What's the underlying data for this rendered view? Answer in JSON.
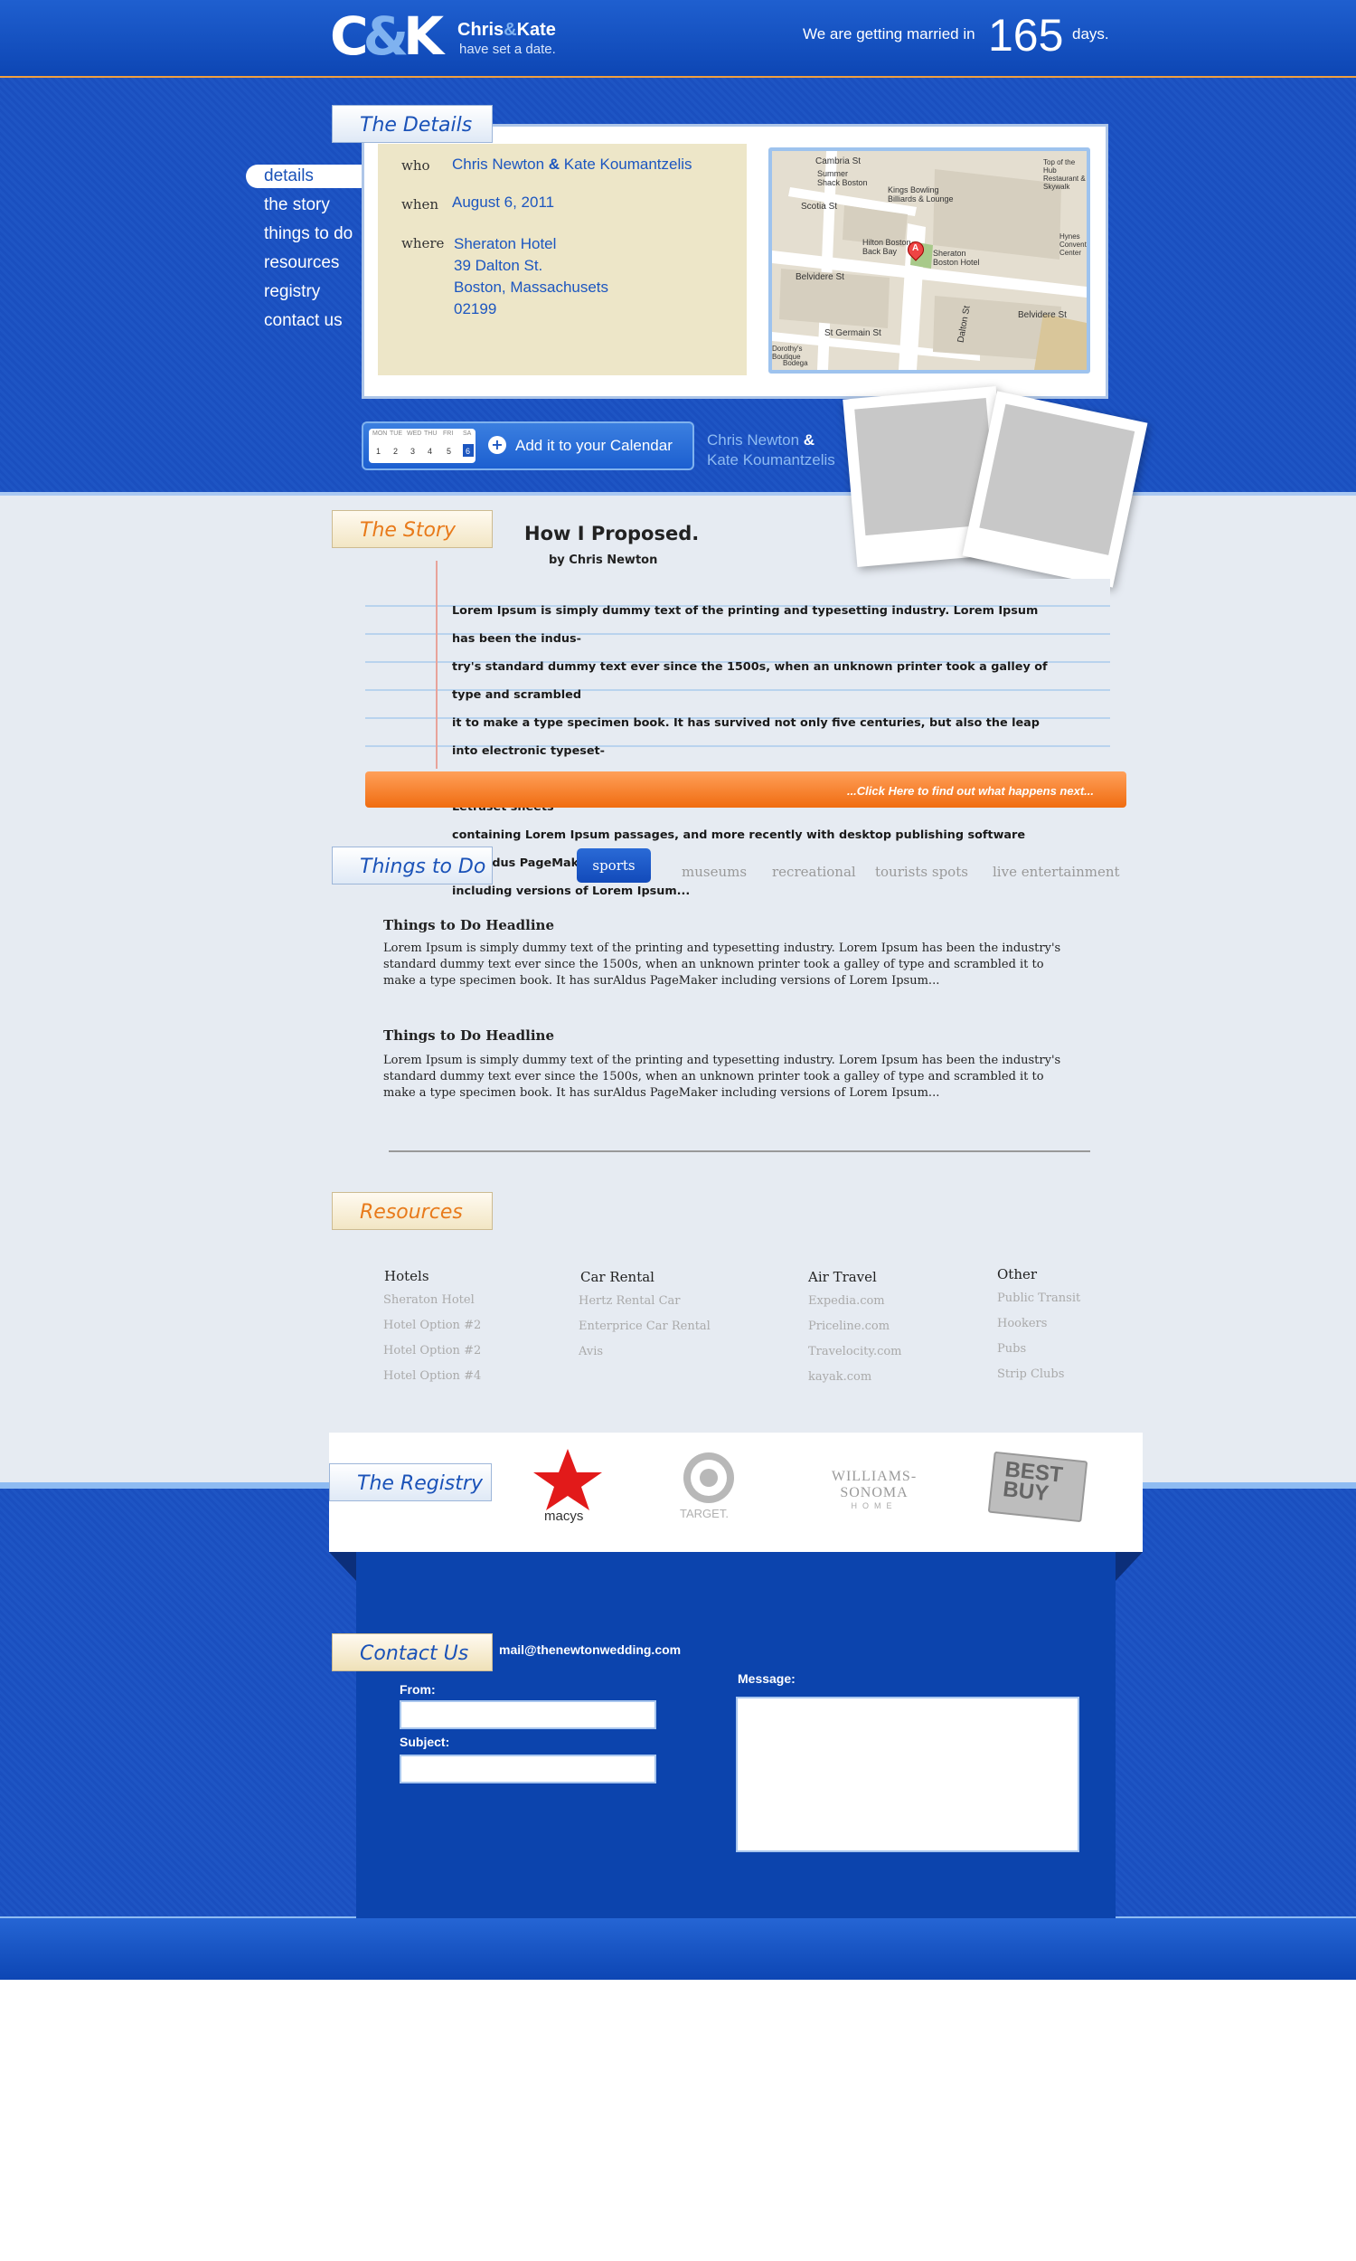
{
  "header": {
    "logo_initials_c": "C",
    "logo_amp": "&",
    "logo_initials_k": "K",
    "logo_name_chris": "Chris",
    "logo_name_kate": "Kate",
    "logo_subtitle": "have set a date.",
    "countdown_prefix": "We are getting married in",
    "countdown_days": "165",
    "countdown_suffix": "days."
  },
  "nav": [
    "details",
    "the story",
    "things to do",
    "resources",
    "registry",
    "contact us"
  ],
  "details": {
    "tab_label": "The Details",
    "who_label": "who",
    "who_name_1": "Chris Newton",
    "who_amp": "&",
    "who_name_2": "Kate Koumantzelis",
    "when_label": "when",
    "when_value": "August 6, 2011",
    "where_label": "where",
    "where_lines": [
      "Sheraton Hotel",
      "39 Dalton St.",
      "Boston, Massachusets",
      "02199"
    ]
  },
  "map": {
    "labels": [
      "Cambria St",
      "Summer Shack Boston",
      "Kings Bowling Billiards & Lounge",
      "Scotia St",
      "Hilton Boston Back Bay",
      "Sheraton Boston Hotel",
      "Belvidere St",
      "Dalton St",
      "Belvidere St",
      "St Germain St",
      "Dorothy's Boutique",
      "Bodega",
      "Top of the Hub Restaurant & Skywalk",
      "Hynes Convention Center"
    ],
    "marker": "A"
  },
  "calendar": {
    "days": [
      "MON",
      "TUE",
      "WED",
      "THU",
      "FRI",
      "SA"
    ],
    "nums": [
      "1",
      "2",
      "3",
      "4",
      "5",
      "6"
    ],
    "label": "Add it to your Calendar",
    "couple_1": "Chris Newton",
    "couple_amp": "&",
    "couple_2": "Kate Koumantzelis"
  },
  "story": {
    "tab_label": "The Story",
    "title": "How I Proposed.",
    "byline": "by Chris Newton",
    "lines": [
      "Lorem Ipsum is simply dummy text of the printing and typesetting industry. Lorem Ipsum has been the indus-",
      "try's standard dummy text ever since the 1500s, when an unknown printer took a galley of type and scrambled",
      "it to make a type specimen book. It has survived not only five centuries, but also the leap into electronic typeset-",
      "ting, remaining essentially unchanged. It was popularised in the 1960s with the release of Letraset sheets",
      "containing Lorem Ipsum passages, and more recently with desktop publishing software like Aldus PageMaker",
      "including versions of Lorem Ipsum..."
    ],
    "read_more": "...Click Here to find out what happens next..."
  },
  "things": {
    "tab_label": "Things to Do",
    "tabs": [
      "sports",
      "museums",
      "recreational",
      "tourists spots",
      "live entertainment"
    ],
    "items": [
      {
        "headline": "Things to Do Headline",
        "body": "Lorem Ipsum is simply dummy text of the printing and typesetting industry. Lorem Ipsum has been the industry's standard dummy text ever since the 1500s, when an unknown printer took a galley of type and scrambled it to make a type specimen book. It has surAldus PageMaker including versions of Lorem Ipsum..."
      },
      {
        "headline": "Things to Do Headline",
        "body": "Lorem Ipsum is simply dummy text of the printing and typesetting industry. Lorem Ipsum has been the industry's standard dummy text ever since the 1500s, when an unknown printer took a galley of type and scrambled it to make a type specimen book. It has surAldus PageMaker including versions of Lorem Ipsum..."
      }
    ]
  },
  "resources": {
    "tab_label": "Resources",
    "columns": [
      {
        "heading": "Hotels",
        "items": [
          "Sheraton Hotel",
          "Hotel Option #2",
          "Hotel Option #2",
          "Hotel Option #4"
        ]
      },
      {
        "heading": "Car Rental",
        "items": [
          "Hertz Rental Car",
          "Enterprice Car Rental",
          "Avis"
        ]
      },
      {
        "heading": "Air Travel",
        "items": [
          "Expedia.com",
          "Priceline.com",
          "Travelocity.com",
          "kayak.com"
        ]
      },
      {
        "heading": "Other",
        "items": [
          "Public Transit",
          "Hookers",
          "Pubs",
          "Strip Clubs"
        ]
      }
    ]
  },
  "registry": {
    "tab_label": "The Registry",
    "macys": "macys",
    "target": "TARGET.",
    "ws_main": "WILLIAMS-SONOMA",
    "ws_sub": "HOME",
    "bestbuy_1": "BEST",
    "bestbuy_2": "BUY"
  },
  "contact": {
    "tab_label": "Contact Us",
    "email": "mail@thenewtonwedding.com",
    "from_label": "From:",
    "subject_label": "Subject:",
    "message_label": "Message:"
  },
  "colors": {
    "brand_blue": "#1a52b8",
    "accent_orange": "#f06c10",
    "paper": "#e6ebf2"
  }
}
